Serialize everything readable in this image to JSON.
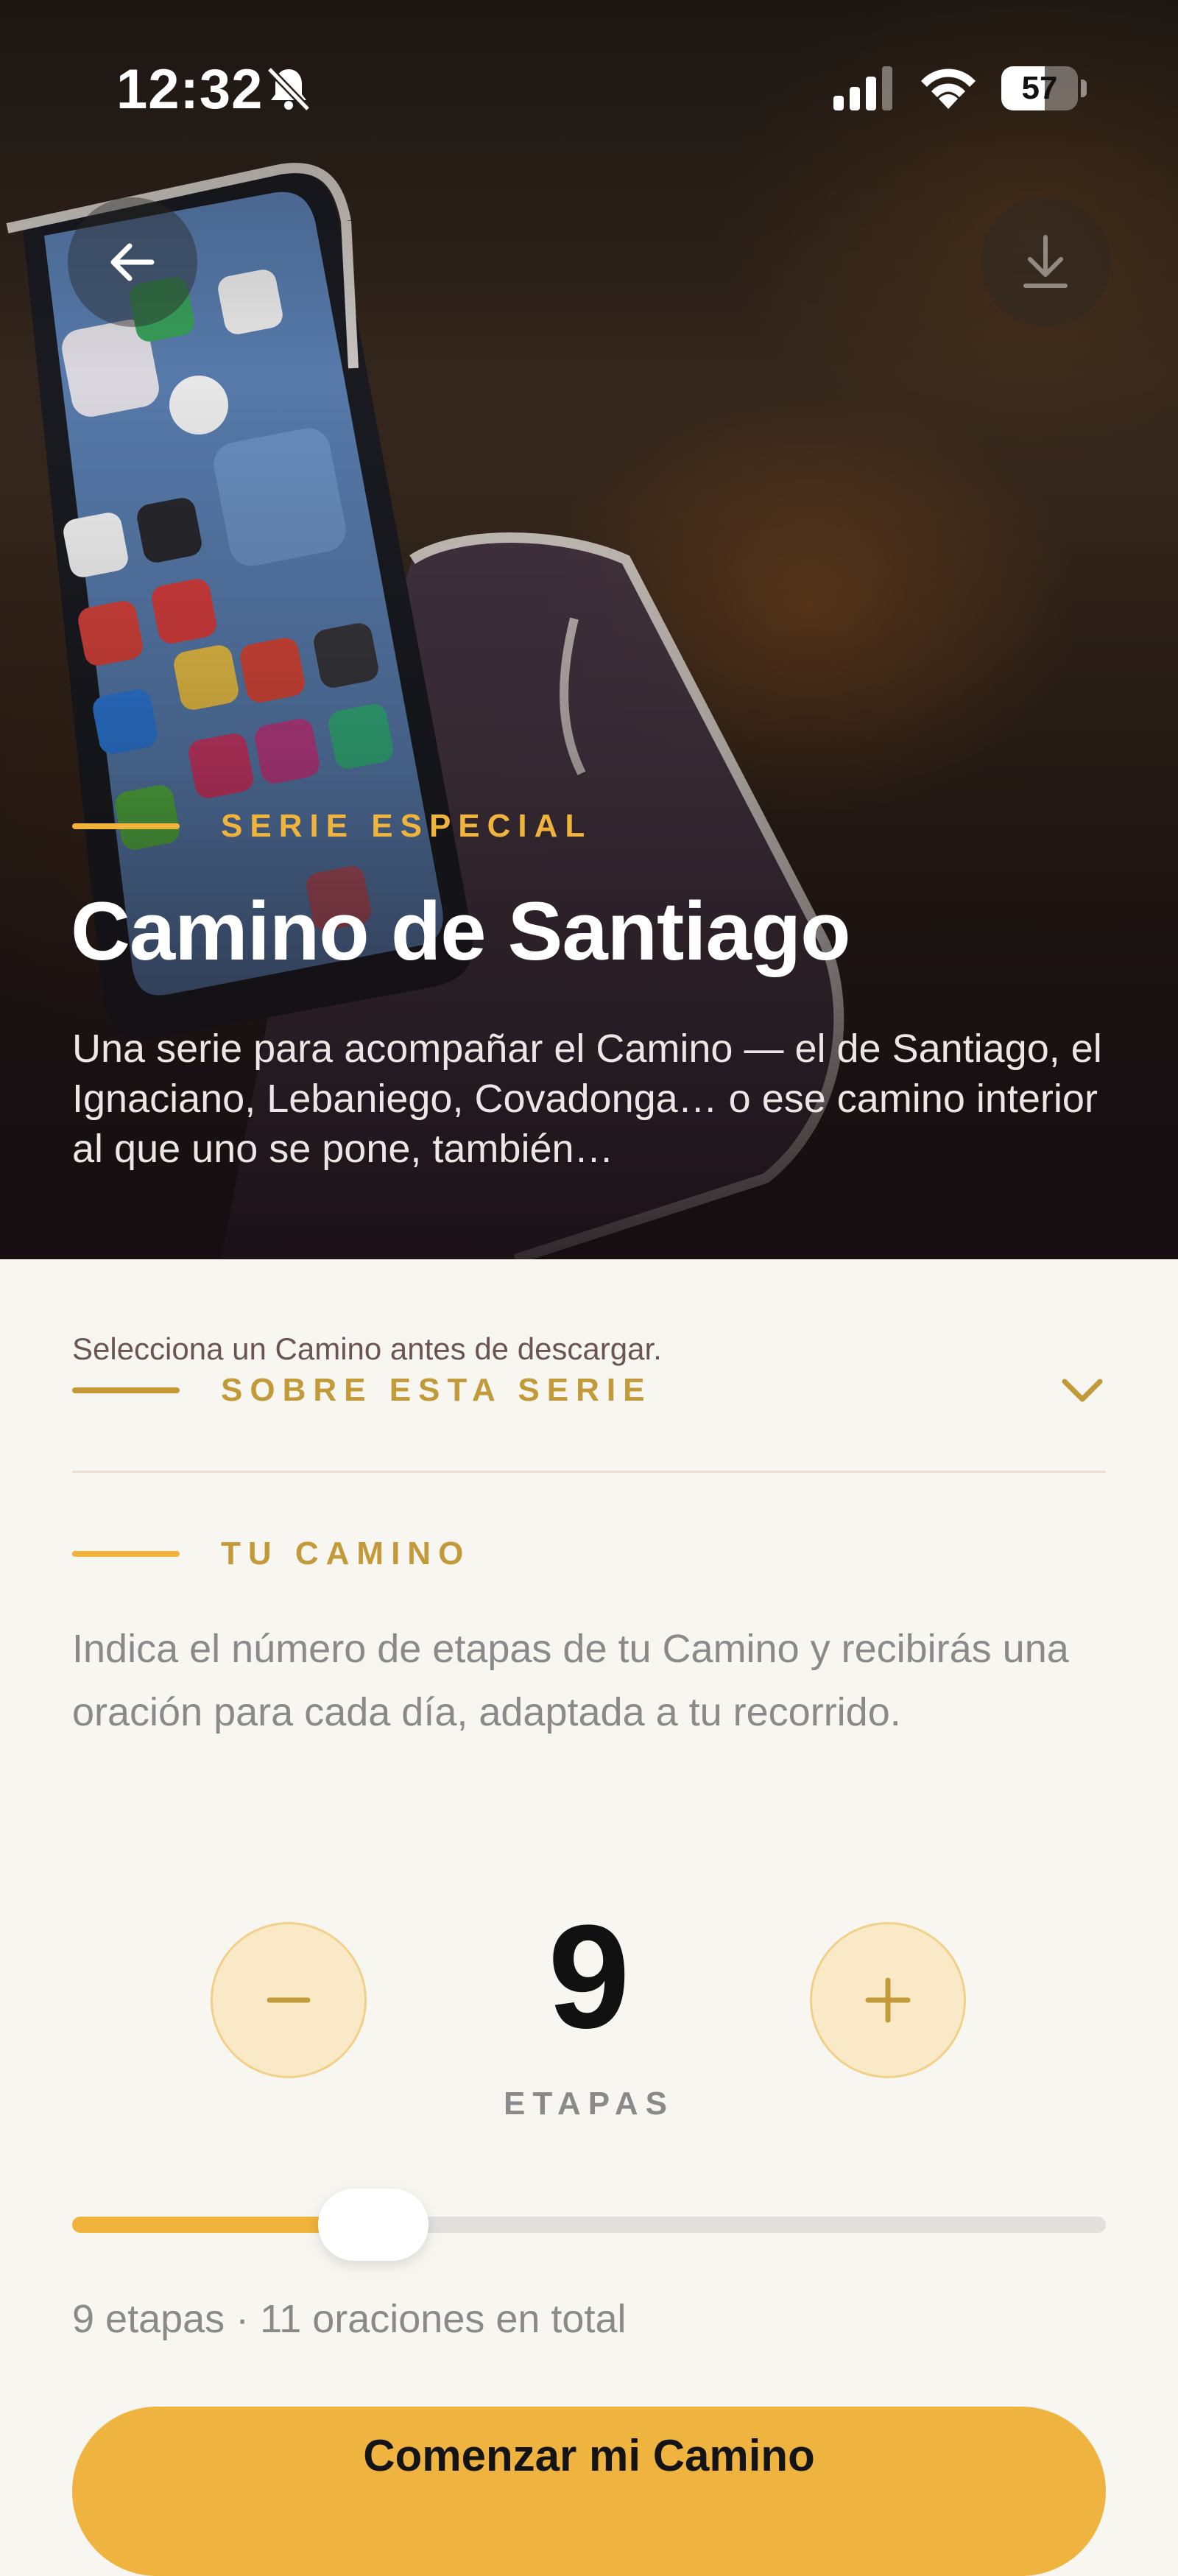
{
  "status_bar": {
    "time": "12:32",
    "battery_percent": "57",
    "battery_level": 0.57,
    "icons": [
      "bell-slash-icon",
      "cellular-signal-icon",
      "wifi-icon",
      "battery-icon"
    ]
  },
  "header": {
    "back_icon": "arrow-left-icon",
    "download_icon": "download-icon"
  },
  "hero": {
    "eyebrow": "SERIE ESPECIAL",
    "title": "Camino de Santiago",
    "description": "Una serie para acompañar el Camino — el de Santiago, el Ignaciano, Lebaniego, Covadonga… o ese camino interior al que uno se pone, también…"
  },
  "about": {
    "hint": "Selecciona un Camino antes de descargar.",
    "label": "SOBRE ESTA SERIE",
    "chevron_icon": "chevron-down-icon"
  },
  "camino": {
    "label": "TU CAMINO",
    "description": "Indica el número de etapas de tu Camino y recibirás una oración para cada día, adaptada a tu recorrido.",
    "stages_value": "9",
    "stages_label": "ETAPAS",
    "minus_icon": "minus-icon",
    "plus_icon": "plus-icon",
    "slider_fraction": 0.277,
    "summary": "9 etapas · 11 oraciones en total",
    "cta_label": "Comenzar mi Camino"
  },
  "colors": {
    "accent": "#f0b43c",
    "accent_dark": "#c39a3a",
    "background": "#f8f6f1",
    "muted_text": "#8a8a8a"
  }
}
